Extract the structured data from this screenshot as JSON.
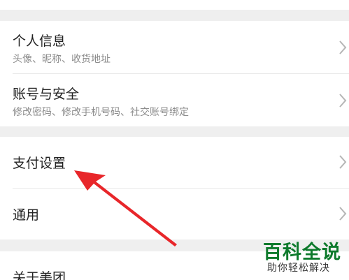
{
  "settings": {
    "group1": [
      {
        "title": "个人信息",
        "subtitle": "头像、昵称、收货地址"
      },
      {
        "title": "账号与安全",
        "subtitle": "修改密码、修改手机号码、社交账号绑定"
      }
    ],
    "group2": [
      {
        "title": "支付设置"
      },
      {
        "title": "通用"
      }
    ],
    "group3": [
      {
        "title": "关于美团"
      }
    ]
  },
  "icons": {
    "chevron": "chevron-right-icon",
    "annotation": "red-arrow-icon"
  },
  "colors": {
    "annotation_arrow": "#e8262a",
    "watermark_green": "#0e7a2c"
  },
  "watermark": {
    "title": "百科全说",
    "subtitle": "助你轻松解决"
  }
}
